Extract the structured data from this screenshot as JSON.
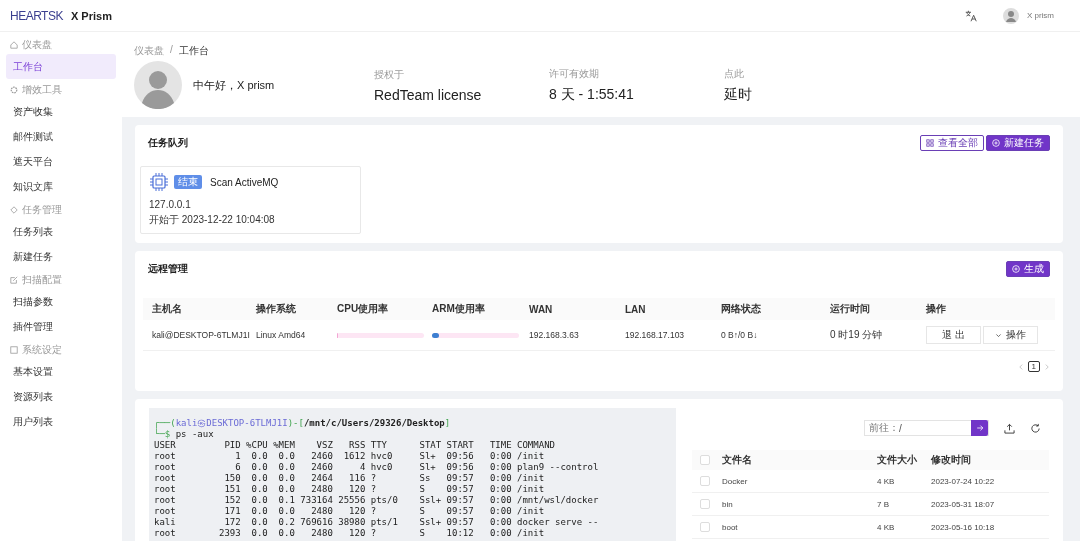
{
  "header": {
    "logo": "HEARTSK",
    "title": "X Prism",
    "user": "X prism"
  },
  "sidebar": {
    "groups": [
      {
        "label": "仪表盘",
        "items": [
          {
            "label": "工作台",
            "selected": true
          }
        ]
      },
      {
        "label": "增效工具",
        "items": [
          {
            "label": "资产收集",
            "selected": false
          },
          {
            "label": "邮件测试",
            "selected": false
          },
          {
            "label": "遮天平台",
            "selected": false
          },
          {
            "label": "知识文库",
            "selected": false
          }
        ]
      },
      {
        "label": "任务管理",
        "items": [
          {
            "label": "任务列表",
            "selected": false
          },
          {
            "label": "新建任务",
            "selected": false
          }
        ]
      },
      {
        "label": "扫描配置",
        "items": [
          {
            "label": "扫描参数",
            "selected": false
          },
          {
            "label": "插件管理",
            "selected": false
          }
        ]
      },
      {
        "label": "系统设定",
        "items": [
          {
            "label": "基本设置",
            "selected": false
          },
          {
            "label": "资源列表",
            "selected": false
          },
          {
            "label": "用户列表",
            "selected": false
          }
        ]
      }
    ]
  },
  "breadcrumb": [
    "仪表盘",
    "工作台"
  ],
  "breadcrumb_separator": "/",
  "greeting": "中午好，X prism",
  "stats": [
    {
      "label": "授权于",
      "value": "RedTeam license"
    },
    {
      "label": "许可有效期",
      "value": "8 天 - 1:55:41"
    },
    {
      "label": "点此",
      "value": "延时"
    }
  ],
  "task_queue": {
    "title": "任务队列",
    "buttons": [
      {
        "label": "查看全部",
        "kind": "outline"
      },
      {
        "label": "新建任务",
        "kind": "primary"
      }
    ],
    "tasks": [
      {
        "status": "结束",
        "name": "Scan ActiveMQ",
        "host": "127.0.0.1",
        "started": "开始于 2023-12-22 10:04:08"
      }
    ]
  },
  "remote": {
    "title": "远程管理",
    "button": "生成",
    "columns": [
      "主机名",
      "操作系统",
      "CPU使用率",
      "ARM使用率",
      "WAN",
      "LAN",
      "网络状态",
      "运行时间",
      "操作"
    ],
    "rows": [
      {
        "host": "kali@DESKTOP-6TLMJ1I",
        "os": "Linux Amd64",
        "cpu": {
          "level": 0.01
        },
        "arm": {
          "level": 0.08
        },
        "wan": "192.168.3.63",
        "lan": "192.168.17.103",
        "network": "0 B↑/0 B↓",
        "uptime": "0 时19 分钟",
        "actions": [
          "退 出",
          "操作"
        ]
      }
    ],
    "page": "1"
  },
  "terminal": {
    "prompt": [
      {
        "text": "┌──(",
        "kind": "frame"
      },
      {
        "text": "kali㉿DESKTOP-6TLMJ1I",
        "kind": "host"
      },
      {
        "text": ")-[",
        "kind": "frame"
      },
      {
        "text": "/mnt/c/Users/29326/Desktop",
        "kind": "path"
      },
      {
        "text": "]",
        "kind": "frame"
      }
    ],
    "command": {
      "prefix": "└─$",
      "text": "ps -aux"
    },
    "output": [
      "USER         PID %CPU %MEM    VSZ   RSS TTY      STAT START   TIME COMMAND",
      "root           1  0.0  0.0   2460  1612 hvc0     Sl+  09:56   0:00 /init",
      "root           6  0.0  0.0   2460     4 hvc0     Sl+  09:56   0:00 plan9 --control",
      "root         150  0.0  0.0   2464   116 ?        Ss   09:57   0:00 /init",
      "root         151  0.0  0.0   2480   120 ?        S    09:57   0:00 /init",
      "root         152  0.0  0.1 733164 25556 pts/0    Ssl+ 09:57   0:00 /mnt/wsl/docker",
      "root         171  0.0  0.0   2480   120 ?        S    09:57   0:00 /init",
      "kali         172  0.0  0.2 769616 38980 pts/1    Ssl+ 09:57   0:00 docker serve --",
      "root        2393  0.0  0.0   2480   120 ?        S    10:12   0:00 /init"
    ]
  },
  "files": {
    "goto_label": "前往：",
    "goto_value": "/",
    "all_checked": false,
    "columns": [
      "文件名",
      "文件大小",
      "修改时间"
    ],
    "rows": [
      {
        "name": "Docker",
        "size": "4 KB",
        "modified": "2023-07-24 10:22",
        "checked": false
      },
      {
        "name": "bin",
        "size": "7 B",
        "modified": "2023-05-31 18:07",
        "checked": false
      },
      {
        "name": "boot",
        "size": "4 KB",
        "modified": "2023-05-16 10:18",
        "checked": false
      }
    ]
  }
}
